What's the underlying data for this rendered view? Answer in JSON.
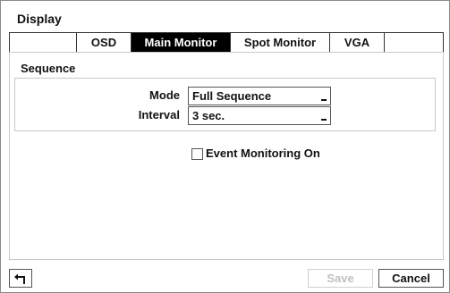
{
  "window": {
    "title": "Display"
  },
  "tabs": [
    {
      "label": "OSD",
      "active": false
    },
    {
      "label": "Main Monitor",
      "active": true
    },
    {
      "label": "Spot Monitor",
      "active": false
    },
    {
      "label": "VGA",
      "active": false
    }
  ],
  "sequence": {
    "label": "Sequence",
    "mode": {
      "label": "Mode",
      "value": "Full Sequence"
    },
    "interval": {
      "label": "Interval",
      "value": "3 sec."
    }
  },
  "event_monitoring": {
    "label": "Event Monitoring On",
    "checked": false
  },
  "footer": {
    "back_icon": "return-arrow-icon",
    "save_label": "Save",
    "save_disabled": true,
    "cancel_label": "Cancel"
  },
  "colors": {
    "active_tab_bg": "#000000",
    "disabled_text": "#c0c0c0",
    "border": "#8a8a8a"
  }
}
